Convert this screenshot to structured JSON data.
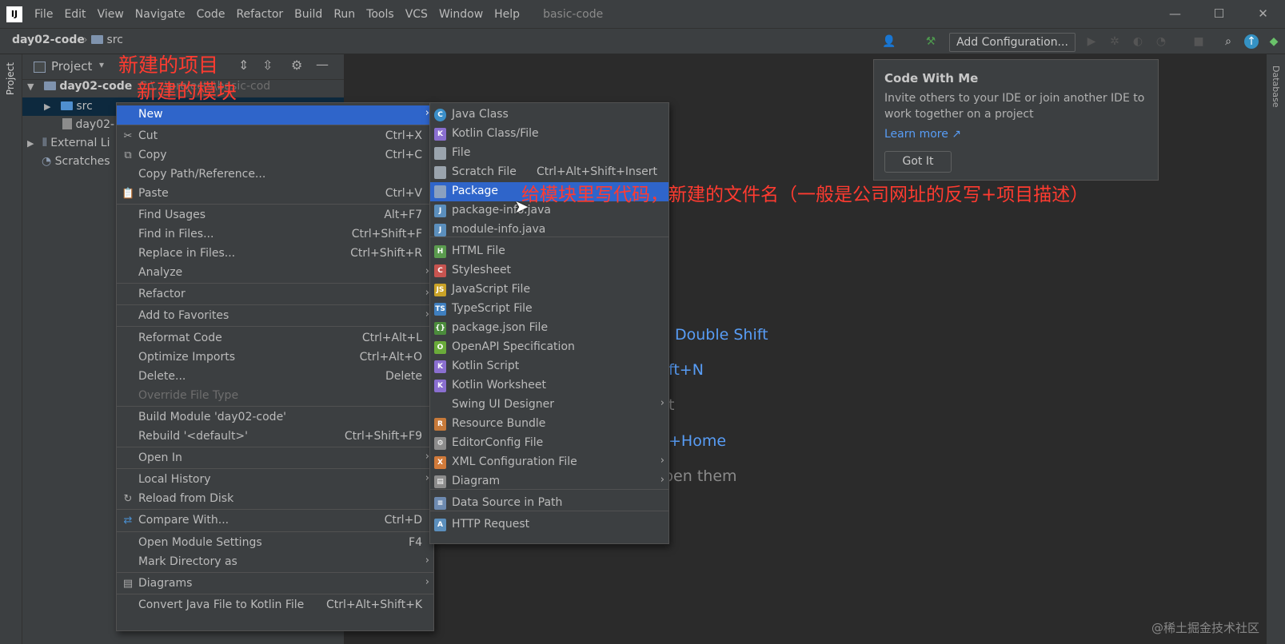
{
  "app": {
    "logo": "IJ",
    "menu": [
      "File",
      "Edit",
      "View",
      "Navigate",
      "Code",
      "Refactor",
      "Build",
      "Run",
      "Tools",
      "VCS",
      "Window",
      "Help"
    ],
    "window_title": "basic-code"
  },
  "navbar": {
    "project": "day02-code",
    "folder": "src",
    "add_config": "Add Configuration..."
  },
  "side_tabs": {
    "left": "Project",
    "right": "Database"
  },
  "project_panel": {
    "header": "Project",
    "tree": [
      {
        "label": "day02-code",
        "extra": "C:\\...\\projects\\basic-cod"
      },
      {
        "label": "src"
      },
      {
        "label": "day02-"
      },
      {
        "label": "External Li"
      },
      {
        "label": "Scratches"
      }
    ]
  },
  "context_menu": [
    {
      "label": "New",
      "shortcut": "",
      "submenu": true,
      "selected": true,
      "icon": ""
    },
    {
      "label": "Cut",
      "shortcut": "Ctrl+X",
      "icon": "scissors-icon"
    },
    {
      "label": "Copy",
      "shortcut": "Ctrl+C",
      "icon": "copy-icon"
    },
    {
      "label": "Copy Path/Reference...",
      "shortcut": ""
    },
    {
      "label": "Paste",
      "shortcut": "Ctrl+V",
      "icon": "clipboard-icon"
    },
    {
      "label": "Find Usages",
      "shortcut": "Alt+F7"
    },
    {
      "label": "Find in Files...",
      "shortcut": "Ctrl+Shift+F"
    },
    {
      "label": "Replace in Files...",
      "shortcut": "Ctrl+Shift+R"
    },
    {
      "label": "Analyze",
      "submenu": true
    },
    {
      "label": "Refactor",
      "submenu": true
    },
    {
      "label": "Add to Favorites",
      "submenu": true
    },
    {
      "label": "Reformat Code",
      "shortcut": "Ctrl+Alt+L"
    },
    {
      "label": "Optimize Imports",
      "shortcut": "Ctrl+Alt+O"
    },
    {
      "label": "Delete...",
      "shortcut": "Delete"
    },
    {
      "label": "Override File Type",
      "disabled": true
    },
    {
      "label": "Build Module 'day02-code'"
    },
    {
      "label": "Rebuild '<default>'",
      "shortcut": "Ctrl+Shift+F9"
    },
    {
      "label": "Open In",
      "submenu": true
    },
    {
      "label": "Local History",
      "submenu": true
    },
    {
      "label": "Reload from Disk",
      "icon": "reload-icon"
    },
    {
      "label": "Compare With...",
      "shortcut": "Ctrl+D",
      "icon": "compare-icon"
    },
    {
      "label": "Open Module Settings",
      "shortcut": "F4"
    },
    {
      "label": "Mark Directory as",
      "submenu": true
    },
    {
      "label": "Diagrams",
      "submenu": true,
      "icon": "diagram-icon"
    },
    {
      "label": "Convert Java File to Kotlin File",
      "shortcut": "Ctrl+Alt+Shift+K"
    }
  ],
  "new_submenu": [
    {
      "label": "Java Class",
      "icon": "java-class-icon",
      "color": "#3b8fc8",
      "glyph": "C"
    },
    {
      "label": "Kotlin Class/File",
      "icon": "kotlin-file-icon",
      "color": "#8a6fd0",
      "glyph": "K"
    },
    {
      "label": "File",
      "icon": "file-icon",
      "color": "#9aa4ad",
      "glyph": ""
    },
    {
      "label": "Scratch File",
      "shortcut": "Ctrl+Alt+Shift+Insert",
      "icon": "scratch-file-icon",
      "color": "#9aa4ad",
      "glyph": ""
    },
    {
      "label": "Package",
      "icon": "package-icon",
      "color": "#8aa0bf",
      "glyph": "",
      "selected": true
    },
    {
      "label": "package-info.java",
      "icon": "java-file-icon",
      "color": "#5b8fbd",
      "glyph": "J"
    },
    {
      "label": "module-info.java",
      "icon": "java-file-icon",
      "color": "#5b8fbd",
      "glyph": "J"
    },
    {
      "label": "HTML File",
      "icon": "html-file-icon",
      "color": "#5a9b4e",
      "glyph": "H"
    },
    {
      "label": "Stylesheet",
      "icon": "css-file-icon",
      "color": "#c75450",
      "glyph": "C"
    },
    {
      "label": "JavaScript File",
      "icon": "js-file-icon",
      "color": "#c9a227",
      "glyph": "JS"
    },
    {
      "label": "TypeScript File",
      "icon": "ts-file-icon",
      "color": "#3f7fbf",
      "glyph": "TS"
    },
    {
      "label": "package.json File",
      "icon": "json-file-icon",
      "color": "#4b8c3c",
      "glyph": "{}"
    },
    {
      "label": "OpenAPI Specification",
      "icon": "openapi-icon",
      "color": "#6aab3a",
      "glyph": "O"
    },
    {
      "label": "Kotlin Script",
      "icon": "kotlin-script-icon",
      "color": "#8a6fd0",
      "glyph": "K"
    },
    {
      "label": "Kotlin Worksheet",
      "icon": "kotlin-worksheet-icon",
      "color": "#8a6fd0",
      "glyph": "K"
    },
    {
      "label": "Swing UI Designer",
      "submenu": true,
      "icon": "",
      "color": "",
      "glyph": ""
    },
    {
      "label": "Resource Bundle",
      "icon": "resource-bundle-icon",
      "color": "#c77a3a",
      "glyph": "R"
    },
    {
      "label": "EditorConfig File",
      "icon": "gear-icon",
      "color": "#8c8c8c",
      "glyph": "⚙"
    },
    {
      "label": "XML Configuration File",
      "submenu": true,
      "icon": "xml-file-icon",
      "color": "#d07a3a",
      "glyph": "X"
    },
    {
      "label": "Diagram",
      "submenu": true,
      "icon": "diagram-icon",
      "color": "#8c8c8c",
      "glyph": "▤"
    },
    {
      "label": "Data Source in Path",
      "icon": "database-icon",
      "color": "#6d8ab0",
      "glyph": "≡"
    },
    {
      "label": "HTTP Request",
      "icon": "http-request-icon",
      "color": "#5b8fbd",
      "glyph": "A"
    }
  ],
  "code_with_me": {
    "title": "Code With Me",
    "body_line1": "Invite others to your IDE or join another IDE to",
    "body_line2": "work together on a project",
    "link": "Learn more ↗",
    "button": "Got It"
  },
  "editor_hints": [
    {
      "text": "Double Shift",
      "kind": "key"
    },
    {
      "text": "ft+N",
      "kind": "key"
    },
    {
      "text": "t",
      "kind": "txt"
    },
    {
      "text": "+Home",
      "kind": "key"
    },
    {
      "text": "pen them",
      "kind": "txt"
    }
  ],
  "annotations": {
    "project": "新建的项目",
    "module": "新建的模块",
    "package": "给模块里写代码，新建的文件名（一般是公司网址的反写+项目描述）"
  },
  "watermark": "@稀土掘金技术社区"
}
